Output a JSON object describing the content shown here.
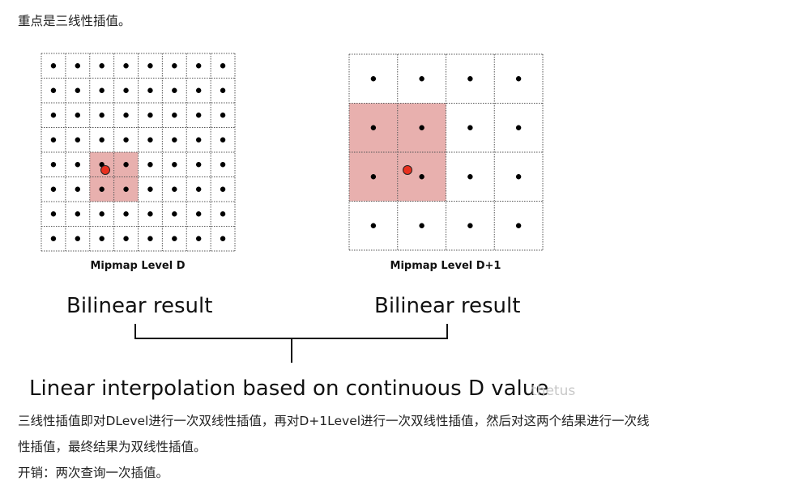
{
  "intro_text": "重点是三线性插值。",
  "figure": {
    "left_grid": {
      "caption": "Mipmap Level D",
      "cells": 8,
      "highlight_cols": [
        2,
        3
      ],
      "highlight_rows": [
        4,
        5
      ]
    },
    "right_grid": {
      "caption": "Mipmap Level D+1",
      "cells": 4,
      "highlight_cols": [
        0,
        1
      ],
      "highlight_rows": [
        1,
        2
      ]
    },
    "left_label": "Bilinear result",
    "right_label": "Bilinear result",
    "bottom_label": "Linear interpolation based on continuous D value",
    "watermark": "thetus",
    "colors": {
      "highlight": "#e8b0ae",
      "sample_point": "#e8301f",
      "dot": "#000000",
      "grid_line": "#555555"
    }
  },
  "paragraph_lines": [
    "三线性插值即对DLevel进行一次双线性插值，再对D+1Level进行一次双线性插值，然后对这两个结果进行一次线",
    "性插值，最终结果为双线性插值。"
  ],
  "cost_text": "开销：两次查询一次插值。"
}
